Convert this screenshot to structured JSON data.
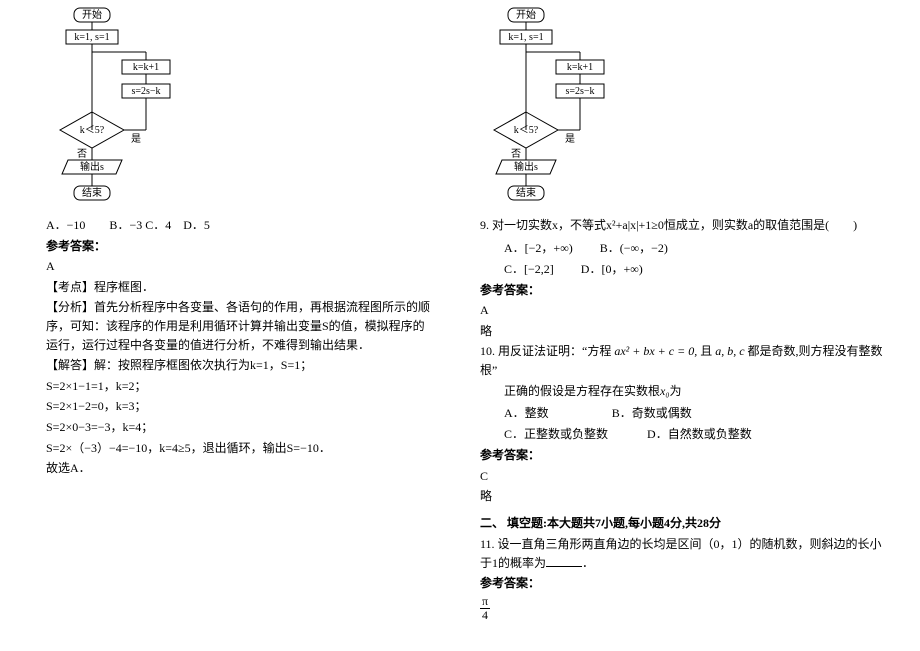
{
  "flowchart": {
    "start": "开始",
    "init": "k=1, s=1",
    "step1": "k=k+1",
    "step2": "s=2s−k",
    "cond": "k＜5?",
    "yes": "是",
    "no": "否",
    "out": "输出s",
    "end": "结束"
  },
  "left": {
    "opts_line": "A．−10　　B．−3 C．4　D．5",
    "ans_label": "参考答案：",
    "ans_val": "A",
    "kd_label": "【考点】",
    "kd_text": "程序框图．",
    "fx_label": "【分析】",
    "fx_text": "首先分析程序中各变量、各语句的作用，再根据流程图所示的顺序，可知：该程序的作用是利用循环计算并输出变量S的值，模拟程序的运行，运行过程中各变量的值进行分析，不难得到输出结果．",
    "jd_label": "【解答】",
    "jd_text": "解：按照程序框图依次执行为k=1，S=1；",
    "s1": "S=2×1−1=1，k=2；",
    "s2": "S=2×1−2=0，k=3；",
    "s3": "S=2×0−3=−3，k=4；",
    "s4": "S=2×（−3）−4=−10，k=4≥5，退出循环，输出S=−10．",
    "s5": "故选A．"
  },
  "right": {
    "q9_stem": "9. 对一切实数x，不等式x²+a|x|+1≥0恒成立，则实数a的取值范围是(　　)",
    "q9_a": "A．[−2，+∞)",
    "q9_b": "B．(−∞，−2)",
    "q9_c": "C．[−2,2]",
    "q9_d": "D．[0，+∞)",
    "ans_label": "参考答案：",
    "q9_ans": "A",
    "q9_note": "略",
    "q10_stem_pre": "10. 用反证法证明：“方程 ",
    "q10_eq": "ax² + bx + c = 0,",
    "q10_stem_mid": " 且 ",
    "q10_abc": "a, b, c",
    "q10_stem_post": " 都是奇数,则方程没有整数根”",
    "q10_assume": "正确的假设是方程存在实数根",
    "q10_assume_sup": "x₀",
    "q10_assume_tail": "为",
    "q10_a": "A．整数",
    "q10_b": "B．奇数或偶数",
    "q10_c": "C．正整数或负整数",
    "q10_d": "D．自然数或负整数",
    "q10_ans": "C",
    "q10_note": "略",
    "section2": "二、 填空题:本大题共7小题,每小题4分,共28分",
    "q11_stem": "11. 设一直角三角形两直角边的长均是区间（0，1）的随机数，则斜边的长小于1的概率为",
    "q11_tail": "．",
    "q11_ans_num": "π",
    "q11_ans_den": "4"
  }
}
